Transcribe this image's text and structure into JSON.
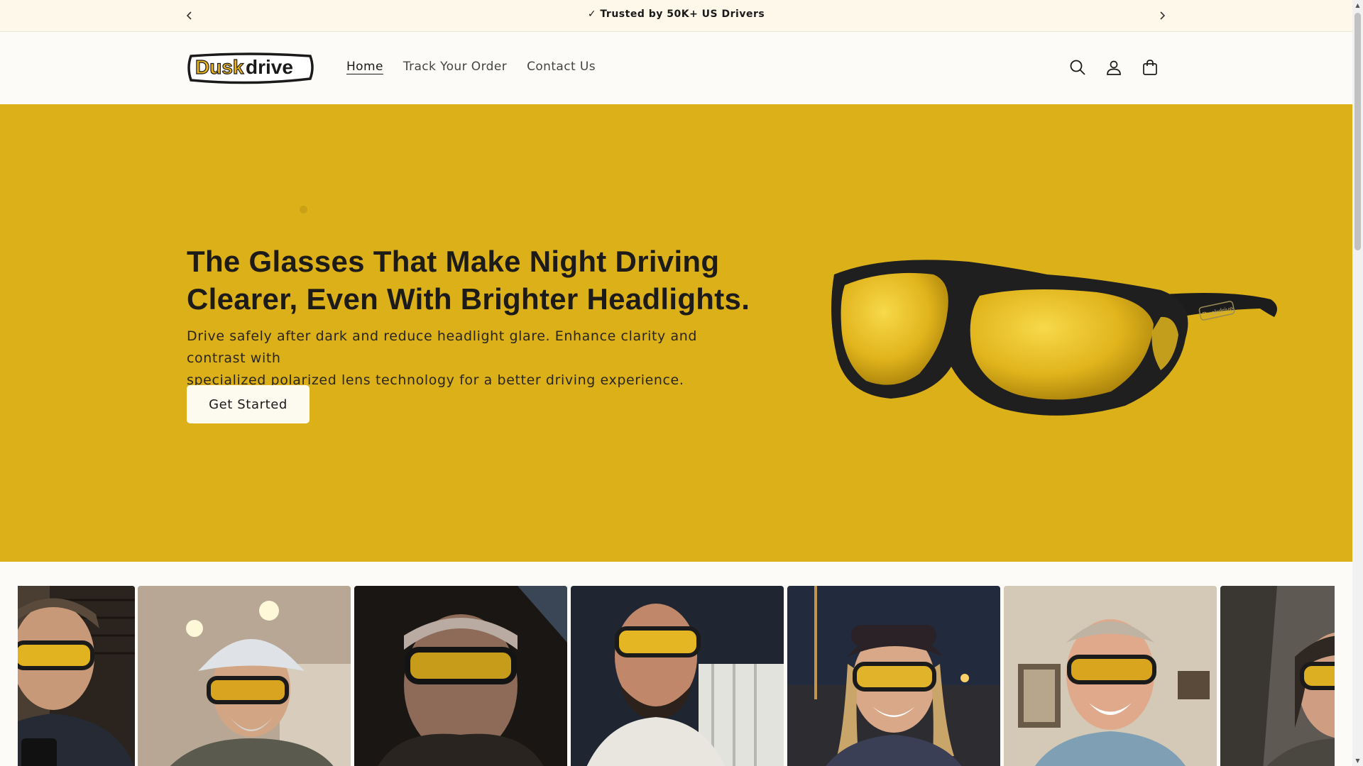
{
  "announcement": {
    "text": "✓ Trusted by 50K+ US Drivers",
    "prev_icon": "chevron-left-icon",
    "next_icon": "chevron-right-icon"
  },
  "header": {
    "logo_text_1": "Dusk",
    "logo_text_2": "drive",
    "nav": [
      {
        "label": "Home",
        "active": true
      },
      {
        "label": "Track Your Order",
        "active": false
      },
      {
        "label": "Contact Us",
        "active": false
      }
    ],
    "icons": [
      "search-icon",
      "account-icon",
      "cart-icon"
    ]
  },
  "hero": {
    "title_line1": "The Glasses That Make Night Driving",
    "title_line2": "Clearer, Even With Brighter Headlights.",
    "subtitle_line1": "Drive safely after dark and reduce headlight glare. Enhance clarity and contrast with",
    "subtitle_line2": "specialized polarized lens technology for a better driving experience.",
    "cta_label": "Get Started",
    "product_brand": "Duskdrive",
    "background_color": "#dbb019"
  },
  "gallery": {
    "photos": [
      {
        "name": "customer-photo-1"
      },
      {
        "name": "customer-photo-2"
      },
      {
        "name": "customer-photo-3"
      },
      {
        "name": "customer-photo-4"
      },
      {
        "name": "customer-photo-5"
      },
      {
        "name": "customer-photo-6"
      },
      {
        "name": "customer-photo-7"
      }
    ]
  }
}
